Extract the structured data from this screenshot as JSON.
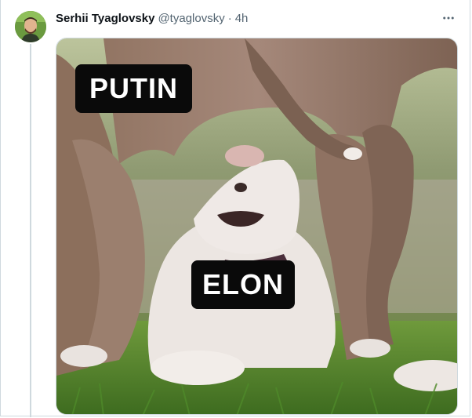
{
  "tweet": {
    "display_name": "Serhii Tyaglovsky",
    "handle": "@tyaglovsky",
    "separator": "·",
    "time": "4h"
  },
  "icons": {
    "more": "more-options-icon",
    "avatar": "avatar"
  },
  "media": {
    "label_top": "PUTIN",
    "label_bottom": "ELON"
  },
  "colors": {
    "name": "#0f1419",
    "secondary_text": "#536471",
    "border": "#cfd9de",
    "label_bg": "#0a0a0a",
    "label_text": "#ffffff"
  }
}
